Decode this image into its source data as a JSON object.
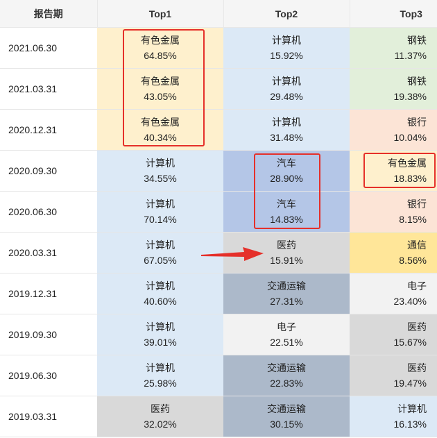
{
  "colors": {
    "有色金属": "#fef0cd",
    "计算机": "#dce9f6",
    "钢铁": "#e2efda",
    "银行": "#fce4d6",
    "汽车": "#b4c6e7",
    "医药": "#d9d9d9",
    "通信": "#ffe699",
    "交通运输": "#acb9ca",
    "电子": "#f2f2f2",
    "highlight": "#e5302a"
  },
  "headers": [
    "报告期",
    "Top1",
    "Top2",
    "Top3"
  ],
  "rows": [
    {
      "date": "2021.06.30",
      "top1": {
        "name": "有色金属",
        "pct": "64.85%"
      },
      "top2": {
        "name": "计算机",
        "pct": "15.92%"
      },
      "top3": {
        "name": "钢铁",
        "pct": "11.37%"
      }
    },
    {
      "date": "2021.03.31",
      "top1": {
        "name": "有色金属",
        "pct": "43.05%"
      },
      "top2": {
        "name": "计算机",
        "pct": "29.48%"
      },
      "top3": {
        "name": "钢铁",
        "pct": "19.38%"
      }
    },
    {
      "date": "2020.12.31",
      "top1": {
        "name": "有色金属",
        "pct": "40.34%"
      },
      "top2": {
        "name": "计算机",
        "pct": "31.48%"
      },
      "top3": {
        "name": "银行",
        "pct": "10.04%"
      }
    },
    {
      "date": "2020.09.30",
      "top1": {
        "name": "计算机",
        "pct": "34.55%"
      },
      "top2": {
        "name": "汽车",
        "pct": "28.90%"
      },
      "top3": {
        "name": "有色金属",
        "pct": "18.83%"
      }
    },
    {
      "date": "2020.06.30",
      "top1": {
        "name": "计算机",
        "pct": "70.14%"
      },
      "top2": {
        "name": "汽车",
        "pct": "14.83%"
      },
      "top3": {
        "name": "银行",
        "pct": "8.15%"
      }
    },
    {
      "date": "2020.03.31",
      "top1": {
        "name": "计算机",
        "pct": "67.05%"
      },
      "top2": {
        "name": "医药",
        "pct": "15.91%"
      },
      "top3": {
        "name": "通信",
        "pct": "8.56%"
      }
    },
    {
      "date": "2019.12.31",
      "top1": {
        "name": "计算机",
        "pct": "40.60%"
      },
      "top2": {
        "name": "交通运输",
        "pct": "27.31%"
      },
      "top3": {
        "name": "电子",
        "pct": "23.40%"
      }
    },
    {
      "date": "2019.09.30",
      "top1": {
        "name": "计算机",
        "pct": "39.01%"
      },
      "top2": {
        "name": "电子",
        "pct": "22.51%"
      },
      "top3": {
        "name": "医药",
        "pct": "15.67%"
      }
    },
    {
      "date": "2019.06.30",
      "top1": {
        "name": "计算机",
        "pct": "25.98%"
      },
      "top2": {
        "name": "交通运输",
        "pct": "22.83%"
      },
      "top3": {
        "name": "医药",
        "pct": "19.47%"
      }
    },
    {
      "date": "2019.03.31",
      "top1": {
        "name": "医药",
        "pct": "32.02%"
      },
      "top2": {
        "name": "交通运输",
        "pct": "30.15%"
      },
      "top3": {
        "name": "计算机",
        "pct": "16.13%"
      }
    }
  ],
  "annotations": [
    {
      "type": "box",
      "target": "Top1 有色金属 2021.06.30–2020.12.31"
    },
    {
      "type": "box",
      "target": "Top2 汽车 2020.09.30–2020.06.30"
    },
    {
      "type": "box",
      "target": "Top3 有色金属 2020.09.30"
    },
    {
      "type": "arrow",
      "target": "Top2 医药 2020.03.31"
    }
  ]
}
